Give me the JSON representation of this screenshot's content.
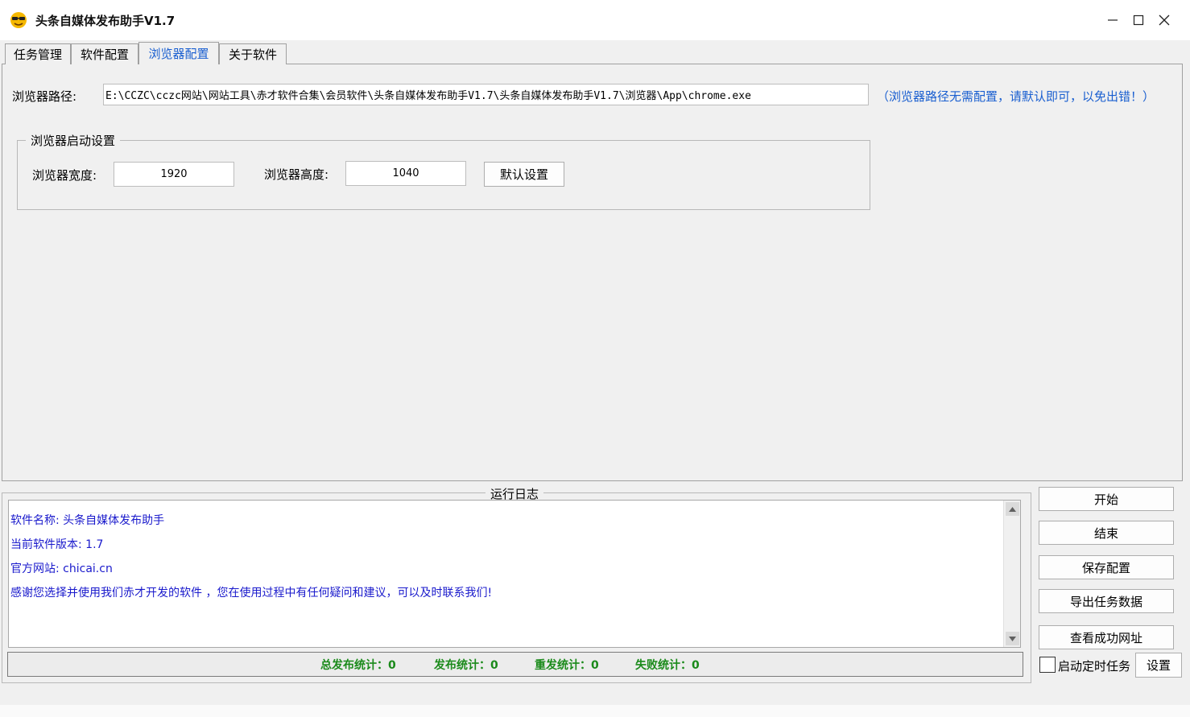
{
  "window": {
    "title": "头条自媒体发布助手V1.7"
  },
  "tabs": [
    {
      "label": "任务管理",
      "active": false
    },
    {
      "label": "软件配置",
      "active": false
    },
    {
      "label": "浏览器配置",
      "active": true
    },
    {
      "label": "关于软件",
      "active": false
    }
  ],
  "browser_config": {
    "path_label": "浏览器路径:",
    "path_value": "E:\\CCZC\\cczc网站\\网站工具\\赤才软件合集\\会员软件\\头条自媒体发布助手V1.7\\头条自媒体发布助手V1.7\\浏览器\\App\\chrome.exe",
    "path_hint": "（浏览器路径无需配置，请默认即可，以免出错！）",
    "startup_group_title": "浏览器启动设置",
    "width_label": "浏览器宽度:",
    "width_value": "1920",
    "height_label": "浏览器高度:",
    "height_value": "1040",
    "default_button": "默认设置"
  },
  "log": {
    "title": "运行日志",
    "lines": [
      "软件名称: 头条自媒体发布助手",
      "当前软件版本: 1.7",
      "官方网站: chicai.cn",
      "感谢您选择并使用我们赤才开发的软件 ，您在使用过程中有任何疑问和建议，可以及时联系我们!"
    ],
    "stats": {
      "total": "总发布统计：0",
      "published": "发布统计：0",
      "republished": "重发统计：0",
      "failed": "失败统计：0"
    }
  },
  "side": {
    "start": "开始",
    "end": "结束",
    "save_config": "保存配置",
    "export": "导出任务数据",
    "view_success": "查看成功网址",
    "scheduled_label": "启动定时任务",
    "scheduled_checked": false,
    "settings": "设置"
  },
  "colors": {
    "link_blue": "#1a5fd0",
    "log_blue": "#1a1acc",
    "stat_green": "#1a8a1a"
  }
}
